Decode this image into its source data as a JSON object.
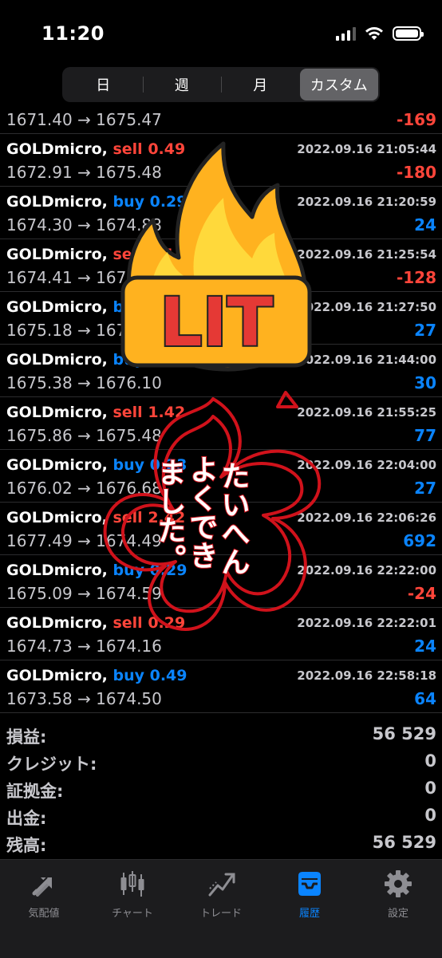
{
  "status": {
    "time": "11:20"
  },
  "segments": [
    {
      "label": "日"
    },
    {
      "label": "週"
    },
    {
      "label": "月"
    },
    {
      "label": "カスタム"
    }
  ],
  "first_row": {
    "price": "1671.40 → 1675.47",
    "profit": "-169"
  },
  "trades": [
    {
      "symbol": "GOLDmicro,",
      "side": "sell",
      "volume": "0.49",
      "date": "2022.09.16 21:05:44",
      "price": "1672.91 → 1675.48",
      "profit": "-180"
    },
    {
      "symbol": "GOLDmicro,",
      "side": "buy",
      "volume": "0.29",
      "date": "2022.09.16 21:20:59",
      "price": "1674.30 → 1674.88",
      "profit": "24"
    },
    {
      "symbol": "GOLDmicro,",
      "side": "sell",
      "volume": "0.14",
      "date": "2022.09.16 21:25:54",
      "price": "1674.41 → 1675.69",
      "profit": "-128"
    },
    {
      "symbol": "GOLDmicro,",
      "side": "buy",
      "volume": "0.14",
      "date": "2022.09.16 21:27:50",
      "price": "1675.18 → 1676.95",
      "profit": "27"
    },
    {
      "symbol": "GOLDmicro,",
      "side": "buy",
      "volume": "0.14",
      "date": "2022.09.16 21:44:00",
      "price": "1675.38 → 1676.10",
      "profit": "30"
    },
    {
      "symbol": "GOLDmicro,",
      "side": "sell",
      "volume": "1.42",
      "date": "2022.09.16 21:55:25",
      "price": "1675.86 → 1675.48",
      "profit": "77"
    },
    {
      "symbol": "GOLDmicro,",
      "side": "buy",
      "volume": "0.23",
      "date": "2022.09.16 22:04:00",
      "price": "1676.02 → 1676.68",
      "profit": "27"
    },
    {
      "symbol": "GOLDmicro,",
      "side": "sell",
      "volume": "2.42",
      "date": "2022.09.16 22:06:26",
      "price": "1677.49 → 1674.49",
      "profit": "692"
    },
    {
      "symbol": "GOLDmicro,",
      "side": "buy",
      "volume": "0.29",
      "date": "2022.09.16 22:22:00",
      "price": "1675.09 → 1674.59",
      "profit": "-24"
    },
    {
      "symbol": "GOLDmicro,",
      "side": "sell",
      "volume": "0.29",
      "date": "2022.09.16 22:22:01",
      "price": "1674.73 → 1674.16",
      "profit": "24"
    },
    {
      "symbol": "GOLDmicro,",
      "side": "buy",
      "volume": "0.49",
      "date": "2022.09.16 22:58:18",
      "price": "1673.58 → 1674.50",
      "profit": "64"
    }
  ],
  "summary": [
    {
      "label": "損益:",
      "value": "56 529"
    },
    {
      "label": "クレジット:",
      "value": "0"
    },
    {
      "label": "証拠金:",
      "value": "0"
    },
    {
      "label": "出金:",
      "value": "0"
    },
    {
      "label": "残高:",
      "value": "56 529"
    }
  ],
  "tabs": [
    {
      "label": "気配値",
      "icon": "quotes-arrows-icon"
    },
    {
      "label": "チャート",
      "icon": "candlestick-chart-icon"
    },
    {
      "label": "トレード",
      "icon": "trade-chart-icon"
    },
    {
      "label": "履歴",
      "icon": "history-inbox-icon"
    },
    {
      "label": "設定",
      "icon": "gear-icon"
    }
  ],
  "stickers": {
    "lit": "LIT",
    "sakura_lines": [
      "たいへん",
      "よくでき",
      "ました。"
    ]
  },
  "colors": {
    "sell": "#ff453a",
    "buy": "#0a84ff",
    "negative": "#ff453a",
    "positive": "#0a84ff",
    "active_tab": "#0a84ff"
  }
}
